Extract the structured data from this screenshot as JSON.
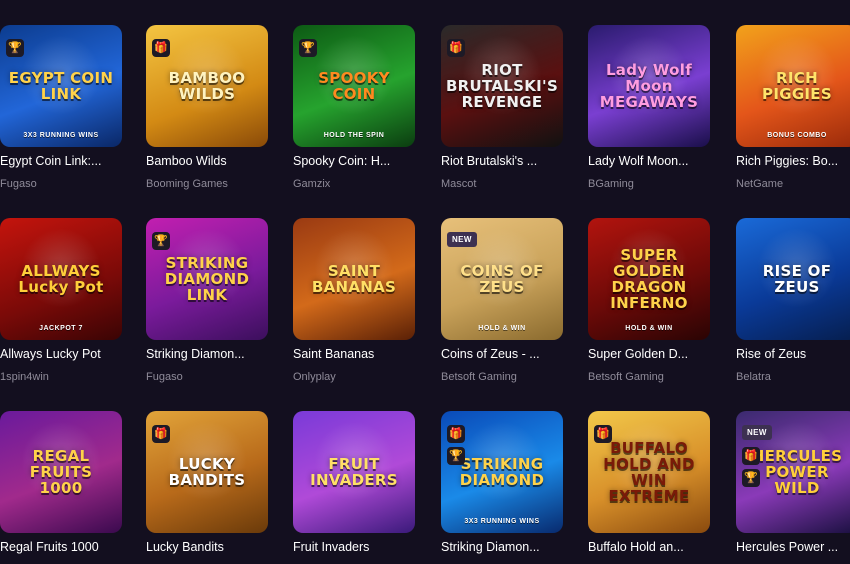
{
  "accent": "#f4b400",
  "background": "#130f1f",
  "games": [
    {
      "name": "Egypt Coin Link:...",
      "provider": "Fugaso",
      "thumb_text": "EGYPT COIN LINK",
      "sub_text": "3X3 RUNNING WINS",
      "bg": "linear-gradient(160deg,#0c3c8f,#2266d8 55%,#0a2766)",
      "text_color": "#ffd24a",
      "badges": [
        "trophy-icon"
      ]
    },
    {
      "name": "Bamboo Wilds",
      "provider": "Booming Games",
      "thumb_text": "BAMBOO WILDS",
      "sub_text": "",
      "bg": "linear-gradient(160deg,#f4c542,#d38a14 60%,#8a4a08)",
      "text_color": "#fff3c0",
      "badges": [
        "gift-icon"
      ]
    },
    {
      "name": "Spooky Coin: H...",
      "provider": "Gamzix",
      "thumb_text": "SPOOKY COIN",
      "sub_text": "HOLD THE SPIN",
      "bg": "linear-gradient(160deg,#0d5a14,#26a32e 55%,#0b3d10)",
      "text_color": "#ff8a1f",
      "badges": [
        "trophy-icon"
      ]
    },
    {
      "name": "Riot Brutalski's ...",
      "provider": "Mascot",
      "thumb_text": "RIOT BRUTALSKI'S REVENGE",
      "sub_text": "",
      "bg": "linear-gradient(160deg,#2a2a2a,#5a1010 55%,#111111)",
      "text_color": "#f1f1f1",
      "badges": [
        "gift-icon"
      ]
    },
    {
      "name": "Lady Wolf Moon...",
      "provider": "BGaming",
      "thumb_text": "Lady Wolf Moon MEGAWAYS",
      "sub_text": "",
      "bg": "linear-gradient(160deg,#2a1b6e,#7a3fd1 55%,#1a0f4a)",
      "text_color": "#ff9de0",
      "badges": []
    },
    {
      "name": "Rich Piggies: Bo...",
      "provider": "NetGame",
      "thumb_text": "RICH PIGGIES",
      "sub_text": "BONUS COMBO",
      "bg": "linear-gradient(160deg,#f2a21b,#e4561a 55%,#9a2a0a)",
      "text_color": "#ffe36a",
      "badges": []
    },
    {
      "name": "Allways Lucky Pot",
      "provider": "1spin4win",
      "thumb_text": "ALLWAYS Lucky Pot",
      "sub_text": "JACKPOT 7",
      "bg": "linear-gradient(160deg,#c4140d,#7a0a08 60%,#3a0404)",
      "text_color": "#ffcf3a",
      "badges": []
    },
    {
      "name": "Striking Diamon...",
      "provider": "Fugaso",
      "thumb_text": "STRIKING DIAMOND LINK",
      "sub_text": "",
      "bg": "linear-gradient(160deg,#c21fb0,#7b1b9c 55%,#3b0f5c)",
      "text_color": "#ffd24a",
      "badges": [
        "trophy-icon"
      ]
    },
    {
      "name": "Saint Bananas",
      "provider": "Onlyplay",
      "thumb_text": "SAINT BANANAS",
      "sub_text": "",
      "bg": "linear-gradient(160deg,#9a3a12,#d36a1a 55%,#5a2006)",
      "text_color": "#ffe066",
      "badges": []
    },
    {
      "name": "Coins of Zeus - ...",
      "provider": "Betsoft Gaming",
      "thumb_text": "COINS OF ZEUS",
      "sub_text": "HOLD & WIN",
      "bg": "linear-gradient(160deg,#e7c07a,#c9a25a 55%,#8a6a2e)",
      "text_color": "#ffe08a",
      "badges": [
        "new"
      ]
    },
    {
      "name": "Super Golden D...",
      "provider": "Betsoft Gaming",
      "thumb_text": "SUPER GOLDEN DRAGON INFERNO",
      "sub_text": "HOLD & WIN",
      "bg": "linear-gradient(160deg,#b2140e,#6e0a08 55%,#2a0404)",
      "text_color": "#ffd24a",
      "badges": []
    },
    {
      "name": "Rise of Zeus",
      "provider": "Belatra",
      "thumb_text": "RISE OF ZEUS",
      "sub_text": "",
      "bg": "linear-gradient(160deg,#1a6ad8,#0a3a98 55%,#061e4e)",
      "text_color": "#ffffff",
      "badges": []
    },
    {
      "name": "Regal Fruits 1000",
      "provider": "",
      "thumb_text": "REGAL FRUITS 1000",
      "sub_text": "",
      "bg": "linear-gradient(160deg,#6a1a9c,#a12a8c 55%,#3a0a4e)",
      "text_color": "#ffd24a",
      "badges": []
    },
    {
      "name": "Lucky Bandits",
      "provider": "",
      "thumb_text": "LUCKY BANDITS",
      "sub_text": "",
      "bg": "linear-gradient(160deg,#e2a43a,#b86a1a 55%,#6a3a0a)",
      "text_color": "#ffffff",
      "badges": [
        "gift-icon"
      ]
    },
    {
      "name": "Fruit Invaders",
      "provider": "",
      "thumb_text": "FRUIT INVADERS",
      "sub_text": "",
      "bg": "linear-gradient(160deg,#7a3ad8,#b04ad8 55%,#3a1a7a)",
      "text_color": "#ffe066",
      "badges": []
    },
    {
      "name": "Striking Diamon...",
      "provider": "",
      "thumb_text": "STRIKING DIAMOND",
      "sub_text": "3X3 RUNNING WINS",
      "bg": "linear-gradient(160deg,#0a4ab8,#1a8ae8 55%,#082a6e)",
      "text_color": "#ffd24a",
      "badges": [
        "gift-icon",
        "trophy-icon"
      ]
    },
    {
      "name": "Buffalo Hold an...",
      "provider": "",
      "thumb_text": "BUFFALO HOLD AND WIN EXTREME",
      "sub_text": "",
      "bg": "linear-gradient(160deg,#f2c84a,#d8902a 55%,#8a4a0e)",
      "text_color": "#7a1a08",
      "badges": [
        "gift-icon"
      ]
    },
    {
      "name": "Hercules Power ...",
      "provider": "",
      "thumb_text": "HERCULES POWER WILD",
      "sub_text": "",
      "bg": "linear-gradient(160deg,#3a2a6e,#8a3ab8 55%,#1a1040)",
      "text_color": "#ffcf3a",
      "badges": [
        "new",
        "gift-icon",
        "trophy-icon"
      ]
    }
  ],
  "icons": {
    "trophy-icon": "🏆",
    "gift-icon": "🎁"
  },
  "labels": {
    "new": "NEW"
  }
}
